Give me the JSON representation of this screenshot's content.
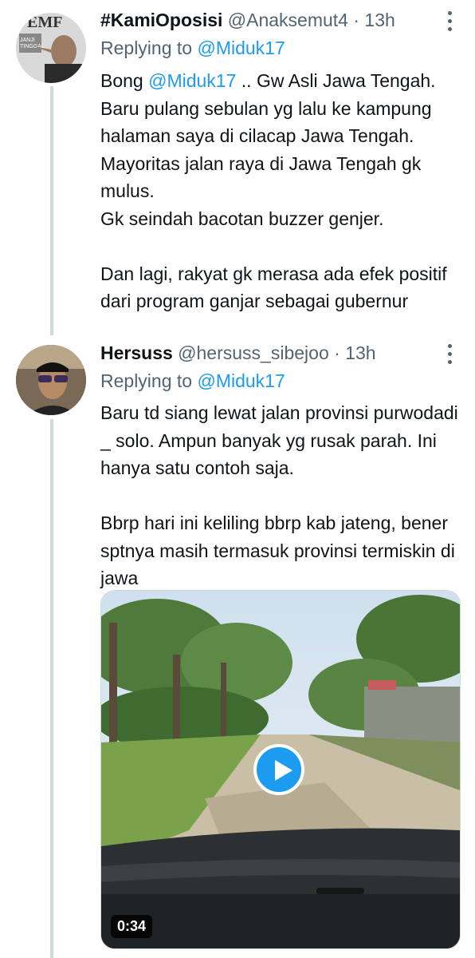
{
  "tweets": [
    {
      "name": "#KamiOposisi",
      "handle": "@Anaksemut4",
      "time": "· 13h",
      "reply_prefix": "Replying to ",
      "reply_to": "@Miduk17",
      "text_prefix": "Bong ",
      "text_mention": "@Miduk17",
      "text_rest": " .. Gw Asli Jawa Tengah.\nBaru pulang sebulan yg lalu ke kampung halaman saya di cilacap Jawa Tengah.\nMayoritas jalan raya di Jawa Tengah gk mulus.\nGk seindah bacotan buzzer genjer.\n\nDan lagi, rakyat gk merasa ada efek positif dari program ganjar sebagai gubernur",
      "avatar_icon": "magazine-cover-avatar"
    },
    {
      "name": "Hersuss",
      "handle": "@hersuss_sibejoo",
      "time": "· 13h",
      "reply_prefix": "Replying to ",
      "reply_to": "@Miduk17",
      "text": "Baru td siang lewat jalan provinsi purwodadi _ solo. Ampun banyak yg rusak parah. Ini hanya satu contoh saja.\n\nBbrp hari ini keliling bbrp kab jateng, bener sptnya masih termasuk provinsi termiskin di jawa",
      "avatar_icon": "user-photo-avatar",
      "video": {
        "duration": "0:34",
        "play_icon": "play-icon"
      }
    }
  ],
  "colors": {
    "link": "#1d9bf0",
    "secondary": "#536471",
    "text": "#0f1419",
    "line": "#cfd9de"
  }
}
